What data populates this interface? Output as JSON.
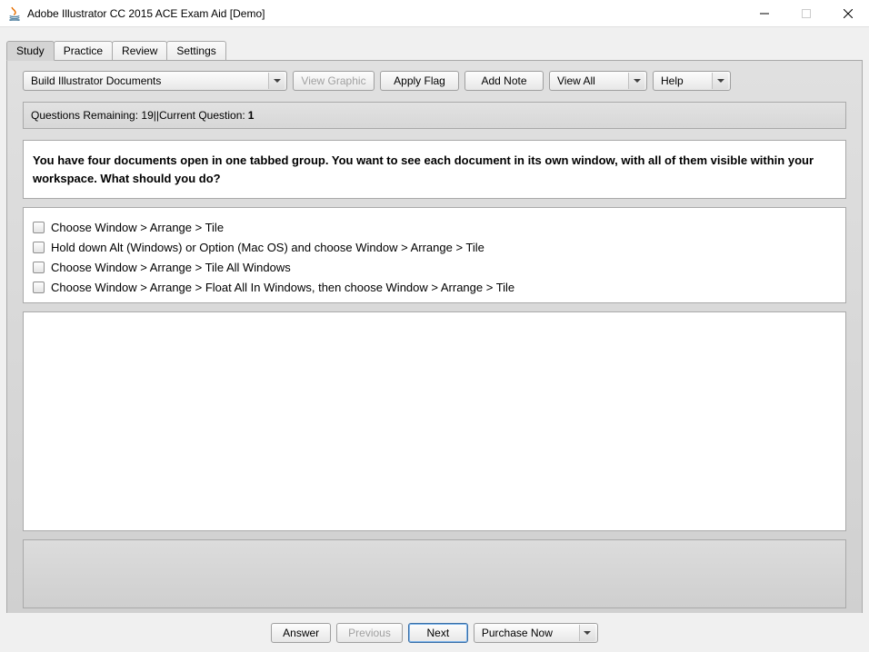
{
  "window": {
    "title": "Adobe Illustrator CC 2015 ACE Exam Aid [Demo]"
  },
  "tabs": {
    "study": "Study",
    "practice": "Practice",
    "review": "Review",
    "settings": "Settings"
  },
  "toolbar": {
    "topic": "Build Illustrator Documents",
    "view_graphic": "View Graphic",
    "apply_flag": "Apply Flag",
    "add_note": "Add Note",
    "view_all": "View All",
    "help": "Help"
  },
  "status": {
    "remaining_label": "Questions Remaining:",
    "remaining_value": "19",
    "separator": " || ",
    "current_label": "Current Question:",
    "current_value": "1"
  },
  "question": "You have four documents open in one tabbed group. You want to see each document in its own window, with all of them visible within your workspace. What should you do?",
  "answers": [
    "Choose Window > Arrange > Tile",
    "Hold down Alt (Windows) or Option (Mac OS) and choose Window > Arrange > Tile",
    "Choose Window > Arrange > Tile All Windows",
    "Choose Window > Arrange > Float All In Windows, then choose Window > Arrange > Tile"
  ],
  "bottom": {
    "answer": "Answer",
    "previous": "Previous",
    "next": "Next",
    "purchase": "Purchase Now"
  }
}
